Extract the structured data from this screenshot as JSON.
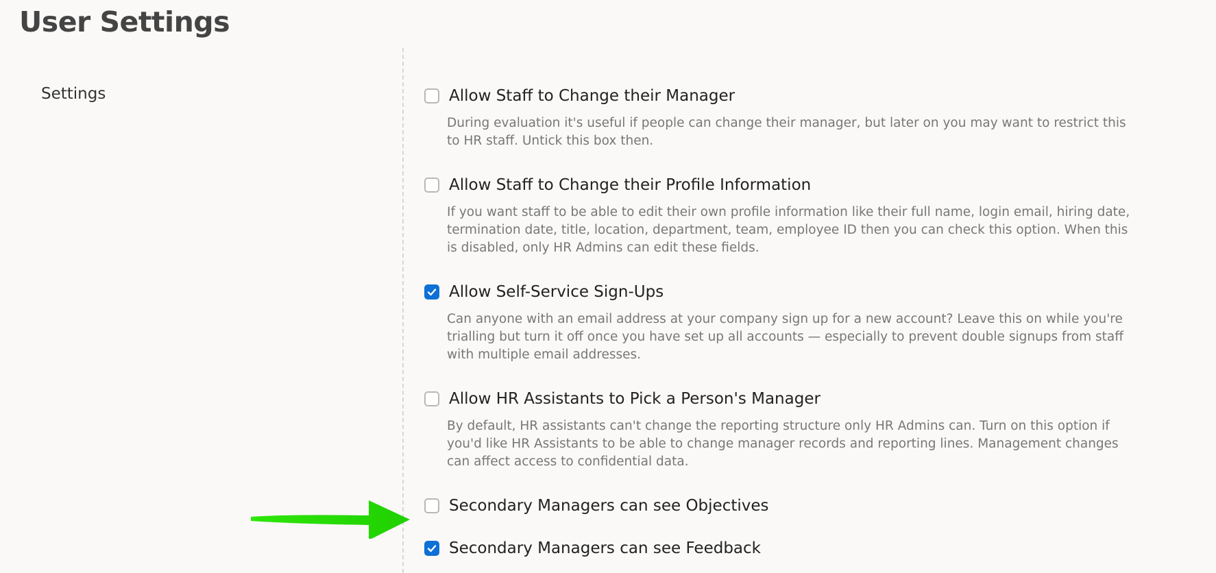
{
  "page": {
    "title": "User Settings"
  },
  "section": {
    "label": "Settings"
  },
  "settings": [
    {
      "label": "Allow Staff to Change their Manager",
      "checked": false,
      "description": "During evaluation it's useful if people can change their manager, but later on you may want to restrict this to HR staff. Untick this box then."
    },
    {
      "label": "Allow Staff to Change their Profile Information",
      "checked": false,
      "description": "If you want staff to be able to edit their own profile information like their full name, login email, hiring date, termination date, title, location, department, team, employee ID then you can check this option. When this is disabled, only HR Admins can edit these fields."
    },
    {
      "label": "Allow Self-Service Sign-Ups",
      "checked": true,
      "description": "Can anyone with an email address at your company sign up for a new account? Leave this on while you're trialling but turn it off once you have set up all accounts — especially to prevent double signups from staff with multiple email addresses."
    },
    {
      "label": "Allow HR Assistants to Pick a Person's Manager",
      "checked": false,
      "description": "By default, HR assistants can't change the reporting structure only HR Admins can. Turn on this option if you'd like HR Assistants to be able to change manager records and reporting lines. Management changes can affect access to confidential data."
    },
    {
      "label": "Secondary Managers can see Objectives",
      "checked": false
    },
    {
      "label": "Secondary Managers can see Feedback",
      "checked": true
    }
  ],
  "colors": {
    "background": "#faf9f7",
    "checkbox_checked": "#0e6fd6",
    "annotation_arrow": "#22dd00"
  },
  "icons": {
    "annotation": "green-arrow-icon",
    "check": "checkmark-icon"
  }
}
